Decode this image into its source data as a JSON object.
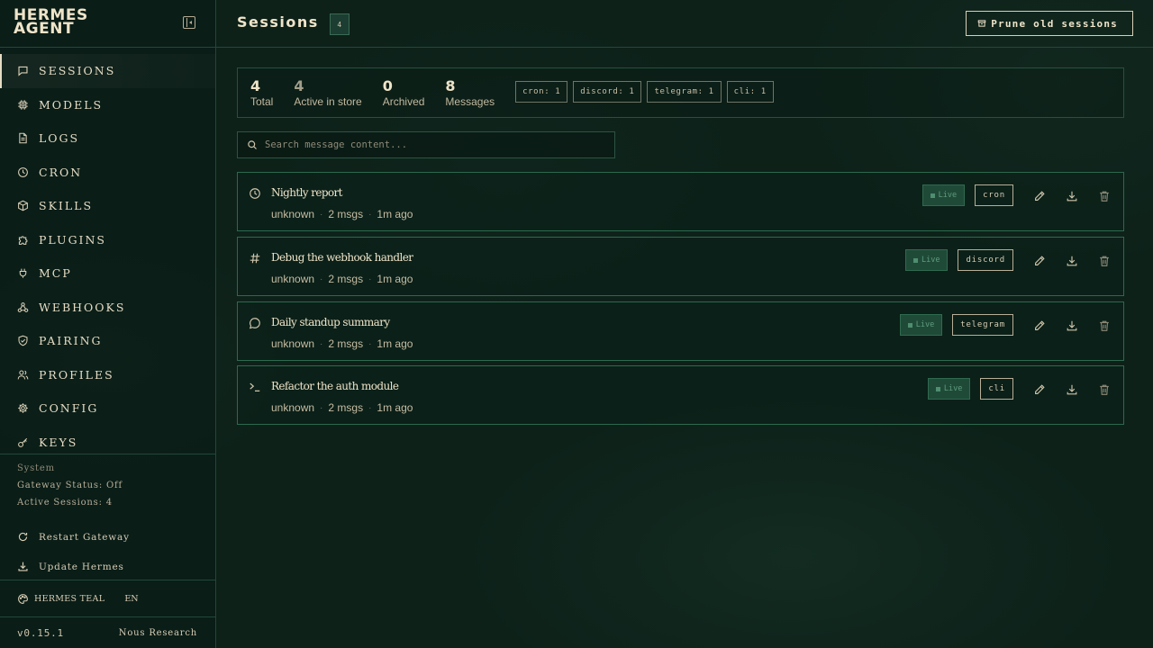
{
  "brand": {
    "line1": "HERMES",
    "line2": "AGENT"
  },
  "sidebar": {
    "items": [
      {
        "label": "SESSIONS",
        "icon": "chat-icon",
        "active": true
      },
      {
        "label": "MODELS",
        "icon": "cpu-icon"
      },
      {
        "label": "LOGS",
        "icon": "file-icon"
      },
      {
        "label": "CRON",
        "icon": "clock-icon"
      },
      {
        "label": "SKILLS",
        "icon": "package-icon"
      },
      {
        "label": "PLUGINS",
        "icon": "puzzle-icon"
      },
      {
        "label": "MCP",
        "icon": "plug-icon"
      },
      {
        "label": "WEBHOOKS",
        "icon": "webhook-icon"
      },
      {
        "label": "PAIRING",
        "icon": "shield-icon"
      },
      {
        "label": "PROFILES",
        "icon": "users-icon"
      },
      {
        "label": "CONFIG",
        "icon": "gear-icon"
      },
      {
        "label": "KEYS",
        "icon": "key-icon"
      }
    ],
    "system": {
      "title": "System",
      "gateway_status": "Gateway Status: Off",
      "active_sessions": "Active Sessions: 4",
      "restart_label": "Restart Gateway",
      "update_label": "Update Hermes"
    },
    "theme_label": "HERMES TEAL",
    "lang_label": "EN",
    "version": "v0.15.1",
    "org": "Nous Research"
  },
  "header": {
    "title": "Sessions",
    "count_chip": "4",
    "prune_label": "Prune old sessions"
  },
  "stats": [
    {
      "value": "4",
      "label": "Total",
      "dim": false
    },
    {
      "value": "4",
      "label": "Active in store",
      "dim": true
    },
    {
      "value": "0",
      "label": "Archived",
      "dim": false
    },
    {
      "value": "8",
      "label": "Messages",
      "dim": false
    }
  ],
  "sources": [
    "cron: 1",
    "discord: 1",
    "telegram: 1",
    "cli: 1"
  ],
  "search": {
    "placeholder": "Search message content..."
  },
  "sessions": [
    {
      "title": "Nightly report",
      "icon": "clock-icon",
      "user": "unknown",
      "msgs": "2 msgs",
      "age": "1m ago",
      "status": "Live",
      "source": "cron"
    },
    {
      "title": "Debug the webhook handler",
      "icon": "hash-icon",
      "user": "unknown",
      "msgs": "2 msgs",
      "age": "1m ago",
      "status": "Live",
      "source": "discord"
    },
    {
      "title": "Daily standup summary",
      "icon": "message-circle-icon",
      "user": "unknown",
      "msgs": "2 msgs",
      "age": "1m ago",
      "status": "Live",
      "source": "telegram"
    },
    {
      "title": "Refactor the auth module",
      "icon": "terminal-icon",
      "user": "unknown",
      "msgs": "2 msgs",
      "age": "1m ago",
      "status": "Live",
      "source": "cli"
    }
  ]
}
